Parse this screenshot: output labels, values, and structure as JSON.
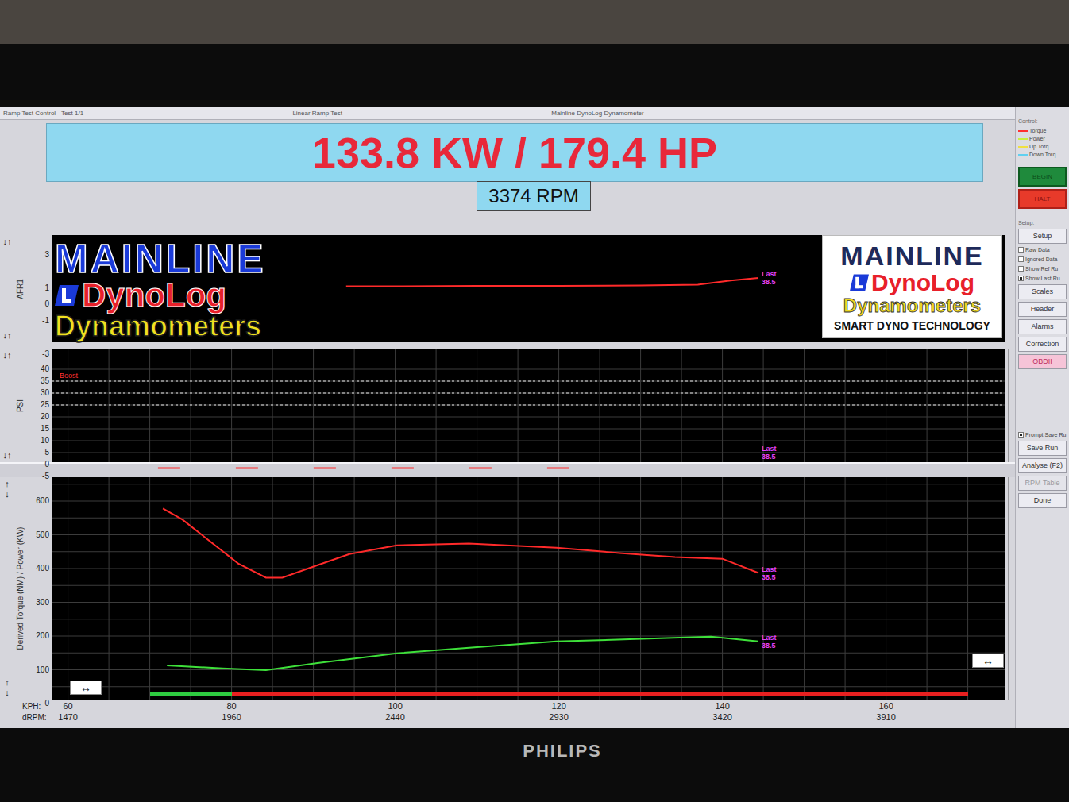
{
  "window": {
    "title_left": "Ramp Test Control - Test 1/1",
    "title_center": "Linear Ramp Test",
    "title_right": "Mainline DynoLog Dynamometer"
  },
  "readout": {
    "power": "133.8 KW / 179.4 HP",
    "rpm": "3374 RPM"
  },
  "logo_large": {
    "brand": "MAINLINE",
    "product": "DynoLog",
    "sub": "Dynamometers"
  },
  "logo_small": {
    "brand": "MAINLINE",
    "product": "DynoLog",
    "sub": "Dynamometers",
    "tagline": "SMART DYNO TECHNOLOGY"
  },
  "charts": {
    "afr": {
      "axis_label": "AFR1",
      "buttons_top": [
        "↓↑"
      ],
      "buttons_bottom": [
        "↓↑"
      ],
      "ticks": [
        "3",
        "1",
        "0",
        "-1",
        "-3"
      ],
      "thresholds": [],
      "series": [
        {
          "name": "AFR1",
          "color": "#ff2a2a",
          "dashed": false,
          "x": [
            94,
            100,
            110,
            120,
            130,
            137,
            141,
            144.4
          ],
          "values": [
            1.1,
            1.1,
            1.12,
            1.12,
            1.15,
            1.2,
            1.45,
            1.6
          ]
        }
      ],
      "markers": [
        {
          "x": 144.4,
          "value": 1.6,
          "lines": [
            "Last",
            "38.5"
          ]
        }
      ]
    },
    "boost": {
      "axis_label": "PSI",
      "title": "Boost",
      "buttons_top": [
        "↓↑"
      ],
      "buttons_bottom": [
        "↓↑"
      ],
      "ticks": [
        "40",
        "35",
        "30",
        "25",
        "20",
        "15",
        "10",
        "5",
        "0",
        "-5"
      ],
      "thresholds": [
        35,
        30,
        25
      ],
      "series": [
        {
          "name": "Boost",
          "color": "#ff2a2a",
          "dashed": true,
          "x": [
            71,
            123
          ],
          "values": [
            -1.5,
            -1.5
          ]
        }
      ],
      "markers": [
        {
          "x": 144.4,
          "value": 5,
          "lines": [
            "Last",
            "38.5"
          ]
        }
      ]
    },
    "torque": {
      "axis_label": "Derived Torque (NM) / Power (KW)",
      "buttons_top": [
        "↑",
        "↓"
      ],
      "buttons_bottom": [
        "↑",
        "↓"
      ],
      "ticks": [
        "600",
        "500",
        "400",
        "300",
        "200",
        "100",
        "0"
      ],
      "thresholds": [],
      "series": [
        {
          "name": "Torque",
          "color": "#ff2a2a",
          "dashed": false,
          "x": [
            71.6,
            74,
            80.8,
            84.2,
            86.2,
            90.5,
            94.4,
            100.2,
            109,
            119.7,
            127.4,
            134.2,
            140,
            144.4
          ],
          "values": [
            578,
            545,
            415,
            373,
            373,
            410,
            443,
            469,
            474,
            462,
            446,
            434,
            429,
            387
          ]
        },
        {
          "name": "Power",
          "color": "#3ee03a",
          "dashed": false,
          "x": [
            72.1,
            78.9,
            84.2,
            90.5,
            100.2,
            110,
            119.7,
            129.4,
            138.6,
            144.4
          ],
          "values": [
            113,
            104,
            99,
            120,
            149,
            167,
            184,
            191,
            198,
            184
          ]
        }
      ],
      "markers": [
        {
          "x": 144.4,
          "value": 387,
          "lines": [
            "Last",
            "38.5"
          ]
        },
        {
          "x": 144.4,
          "value": 184,
          "lines": [
            "Last",
            "38.5"
          ]
        }
      ]
    }
  },
  "speed_bar": {
    "level": 0.1
  },
  "scroll_buttons": {
    "left": "↔",
    "right": "↔"
  },
  "x_axis": {
    "kph_label": "KPH:",
    "drpm_label": "dRPM:",
    "ticks": [
      {
        "kph": "60",
        "drpm": "1470"
      },
      {
        "kph": "80",
        "drpm": "1960"
      },
      {
        "kph": "100",
        "drpm": "2440"
      },
      {
        "kph": "120",
        "drpm": "2930"
      },
      {
        "kph": "140",
        "drpm": "3420"
      },
      {
        "kph": "160",
        "drpm": "3910"
      }
    ]
  },
  "control_panel": {
    "control_label": "Control:",
    "legend": [
      {
        "label": "Torque",
        "color": "#ff3030"
      },
      {
        "label": "Power",
        "color": "#c8f040"
      },
      {
        "label": "Up Torq",
        "color": "#f0e040"
      },
      {
        "label": "Down Torq",
        "color": "#60d0f0"
      }
    ],
    "begin": "BEGIN",
    "halt": "HALT",
    "setup_label": "Setup:",
    "setup_button": "Setup",
    "options": [
      {
        "label": "Raw Data",
        "checked": false
      },
      {
        "label": "Ignored Data",
        "checked": false
      },
      {
        "label": "Show Ref Ru",
        "checked": false
      },
      {
        "label": "Show Last Ru",
        "checked": true
      }
    ],
    "buttons": [
      {
        "label": "Scales",
        "highlighted": false
      },
      {
        "label": "Header",
        "highlighted": false
      },
      {
        "label": "Alarms",
        "highlighted": false
      },
      {
        "label": "Correction",
        "highlighted": false
      },
      {
        "label": "OBDII",
        "highlighted": true
      }
    ],
    "prompt": {
      "label": "Prompt Save Ru",
      "checked": true
    },
    "actions": [
      {
        "label": "Save Run",
        "disabled": false
      },
      {
        "label": "Analyse (F2)",
        "disabled": false
      },
      {
        "label": "RPM Table",
        "disabled": true
      },
      {
        "label": "Done",
        "disabled": false
      }
    ]
  },
  "monitor": {
    "brand": "PHILIPS"
  }
}
